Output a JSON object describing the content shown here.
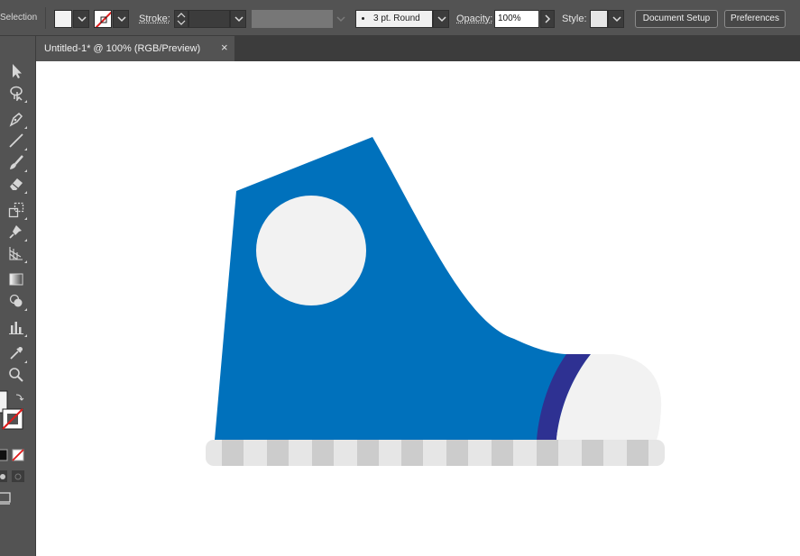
{
  "control_bar": {
    "selection_label": "Selection",
    "stroke_label": "Stroke:",
    "stroke_profile": "3 pt. Round",
    "opacity_label": "Opacity:",
    "opacity_value": "100%",
    "style_label": "Style:",
    "document_setup": "Document Setup",
    "preferences": "Preferences"
  },
  "document_tab": {
    "title": "Untitled-1* @ 100% (RGB/Preview)",
    "close_glyph": "×"
  },
  "tools": [
    {
      "name": "selection-tool-icon"
    },
    {
      "name": "lasso-tool-icon"
    },
    {
      "name": "pen-tool-icon"
    },
    {
      "name": "line-tool-icon"
    },
    {
      "name": "paintbrush-tool-icon"
    },
    {
      "name": "eraser-tool-icon"
    },
    {
      "name": "scale-tool-icon"
    },
    {
      "name": "puppet-warp-tool-icon"
    },
    {
      "name": "perspective-grid-tool-icon"
    },
    {
      "name": "gradient-tool-icon"
    },
    {
      "name": "shape-builder-tool-icon"
    },
    {
      "name": "graph-tool-icon"
    },
    {
      "name": "eyedropper-tool-icon"
    },
    {
      "name": "zoom-tool-icon"
    }
  ],
  "colors": {
    "shoe_body": "#0071bc",
    "toe_band": "#2e3192",
    "toe_cap": "#f2f2f2",
    "eyelet": "#f2f2f2",
    "sole_dark": "#cccccc",
    "sole_light": "#e6e6e6",
    "ui_bg": "#535353",
    "ui_dark": "#3c3c3c"
  }
}
